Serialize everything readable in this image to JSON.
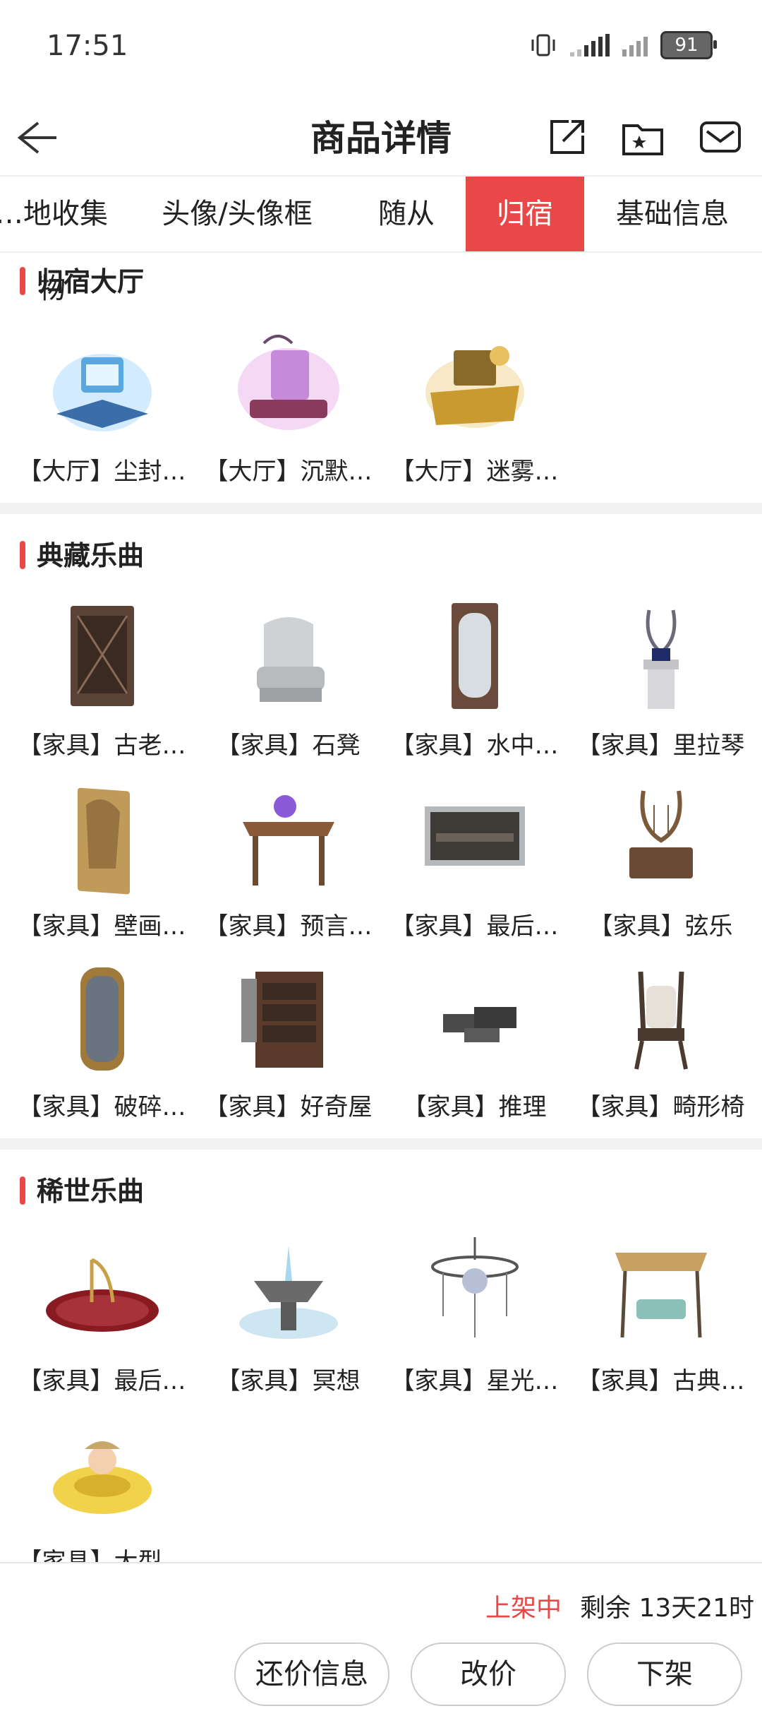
{
  "status_bar": {
    "time": "17:51",
    "battery": "91"
  },
  "header": {
    "title": "商品详情"
  },
  "tabs": [
    "…地收集物",
    "头像/头像框",
    "随从",
    "归宿",
    "基础信息"
  ],
  "sections": [
    {
      "title": "归宿大厅",
      "items": [
        {
          "label": "【大厅】尘封…",
          "icon": "hall-dusty-icon"
        },
        {
          "label": "【大厅】沉默…",
          "icon": "hall-silent-icon"
        },
        {
          "label": "【大厅】迷雾…",
          "icon": "hall-mist-icon"
        }
      ]
    },
    {
      "title": "典藏乐曲",
      "items": [
        {
          "label": "【家具】古老…",
          "icon": "cabinet-icon"
        },
        {
          "label": "【家具】石凳",
          "icon": "stone-chair-icon"
        },
        {
          "label": "【家具】水中…",
          "icon": "mirror-door-icon"
        },
        {
          "label": "【家具】里拉琴",
          "icon": "lyre-statue-icon"
        },
        {
          "label": "【家具】壁画…",
          "icon": "mural-icon"
        },
        {
          "label": "【家具】预言…",
          "icon": "prophecy-table-icon"
        },
        {
          "label": "【家具】最后…",
          "icon": "painting-icon"
        },
        {
          "label": "【家具】弦乐",
          "icon": "harp-icon"
        },
        {
          "label": "【家具】破碎…",
          "icon": "broken-mirror-icon"
        },
        {
          "label": "【家具】好奇屋",
          "icon": "curio-cabinet-icon"
        },
        {
          "label": "【家具】推理",
          "icon": "books-icon"
        },
        {
          "label": "【家具】畸形椅",
          "icon": "twisted-chair-icon"
        }
      ]
    },
    {
      "title": "稀世乐曲",
      "items": [
        {
          "label": "【家具】最后…",
          "icon": "carpet-harp-icon"
        },
        {
          "label": "【家具】冥想",
          "icon": "fountain-icon"
        },
        {
          "label": "【家具】星光…",
          "icon": "chandelier-icon"
        },
        {
          "label": "【家具】古典…",
          "icon": "swing-icon"
        },
        {
          "label": "【家具】大型…",
          "icon": "float-ring-icon"
        }
      ]
    }
  ],
  "bottom": {
    "status": "上架中",
    "remaining": "剩余 13天21时",
    "buttons": [
      "还价信息",
      "改价",
      "下架"
    ]
  },
  "colors": {
    "accent": "#e84848",
    "gap": "#f2f2f2"
  }
}
